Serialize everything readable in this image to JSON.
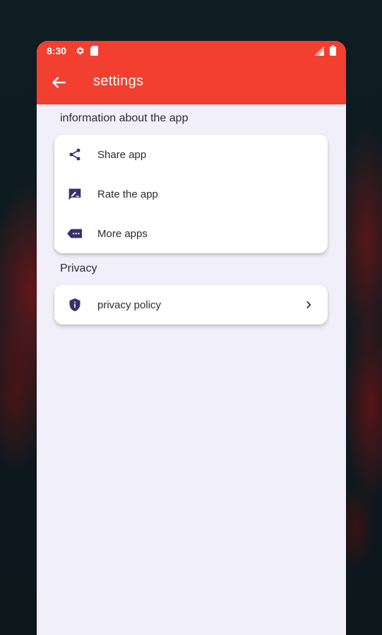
{
  "statusbar": {
    "time": "8:30",
    "icons": [
      "gear-icon",
      "sd-card-icon",
      "signal-icon",
      "battery-icon"
    ]
  },
  "appbar": {
    "title": "settings",
    "back_icon": "arrow-left-icon"
  },
  "sections": [
    {
      "title": "information about the app",
      "items": [
        {
          "label": "Share app",
          "icon": "share-icon"
        },
        {
          "label": "Rate the app",
          "icon": "rate-icon"
        },
        {
          "label": "More apps",
          "icon": "more-apps-icon"
        }
      ]
    },
    {
      "title": "Privacy",
      "items": [
        {
          "label": "privacy policy",
          "icon": "shield-icon",
          "trailing": "chevron-right-icon"
        }
      ]
    }
  ],
  "colors": {
    "accent": "#f33f2f",
    "background": "#f1f0fa",
    "icon": "#3b2f6a",
    "text": "#2c2a3a"
  }
}
